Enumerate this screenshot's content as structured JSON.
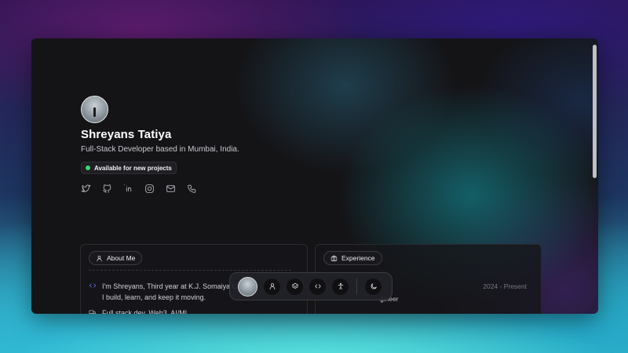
{
  "profile": {
    "name": "Shreyans Tatiya",
    "tagline": "Full-Stack Developer based in Mumbai, India.",
    "status": "Available for new projects",
    "status_color": "#3ad96b",
    "socials": [
      "twitter-icon",
      "github-icon",
      "linkedin-icon",
      "instagram-icon",
      "mail-icon",
      "phone-icon"
    ]
  },
  "about": {
    "chip_label": "About Me",
    "intro_line1": "I'm Shreyans, Third year at K.J. Somaiya Co",
    "intro_line2": "I build, learn, and keep it moving.",
    "stack": "Full stack dev, Web3, AI/ML"
  },
  "experience": {
    "chip_label": "Experience",
    "date": "2024 - Present",
    "role_fragment": "gineer"
  },
  "dock": {
    "items": [
      "avatar",
      "user-icon",
      "layers-icon",
      "code-icon",
      "accessibility-icon",
      "moon-icon"
    ]
  },
  "colors": {
    "accent": "#6f70ff",
    "card_bg": "#16161a"
  }
}
